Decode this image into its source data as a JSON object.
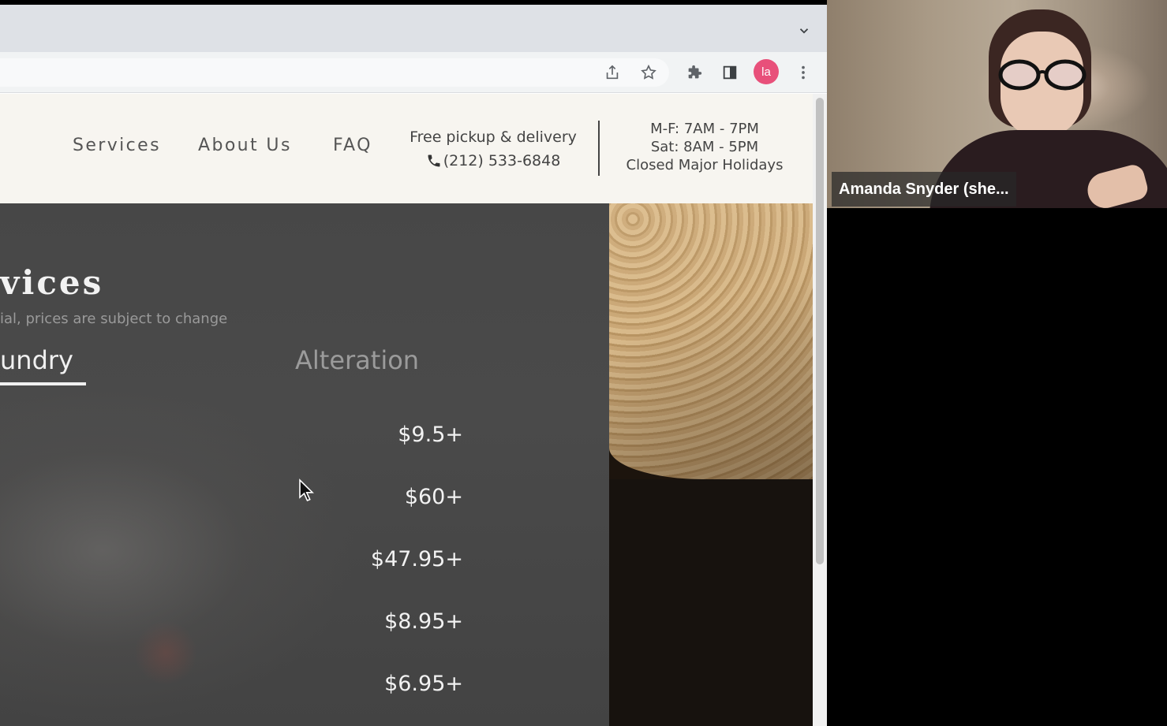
{
  "site": {
    "nav": [
      "Services",
      "About Us",
      "FAQ"
    ],
    "pickup_line": "Free pickup & delivery",
    "phone": "(212) 533-6848",
    "hours": [
      "M-F: 7AM - 7PM",
      "Sat: 8AM - 5PM",
      "Closed Major Holidays"
    ]
  },
  "hero": {
    "title": "vices",
    "subtitle": "ial, prices are subject to change",
    "tabs": [
      {
        "label": "undry",
        "active": true
      },
      {
        "label": "Alteration",
        "active": false
      }
    ],
    "prices": [
      "$9.5+",
      "$60+",
      "$47.95+",
      "$8.95+",
      "$6.95+"
    ]
  },
  "browser": {
    "profile_initials": "la",
    "profile_color": "#e8507a"
  },
  "video": {
    "participant_name": "Amanda Snyder (she..."
  }
}
